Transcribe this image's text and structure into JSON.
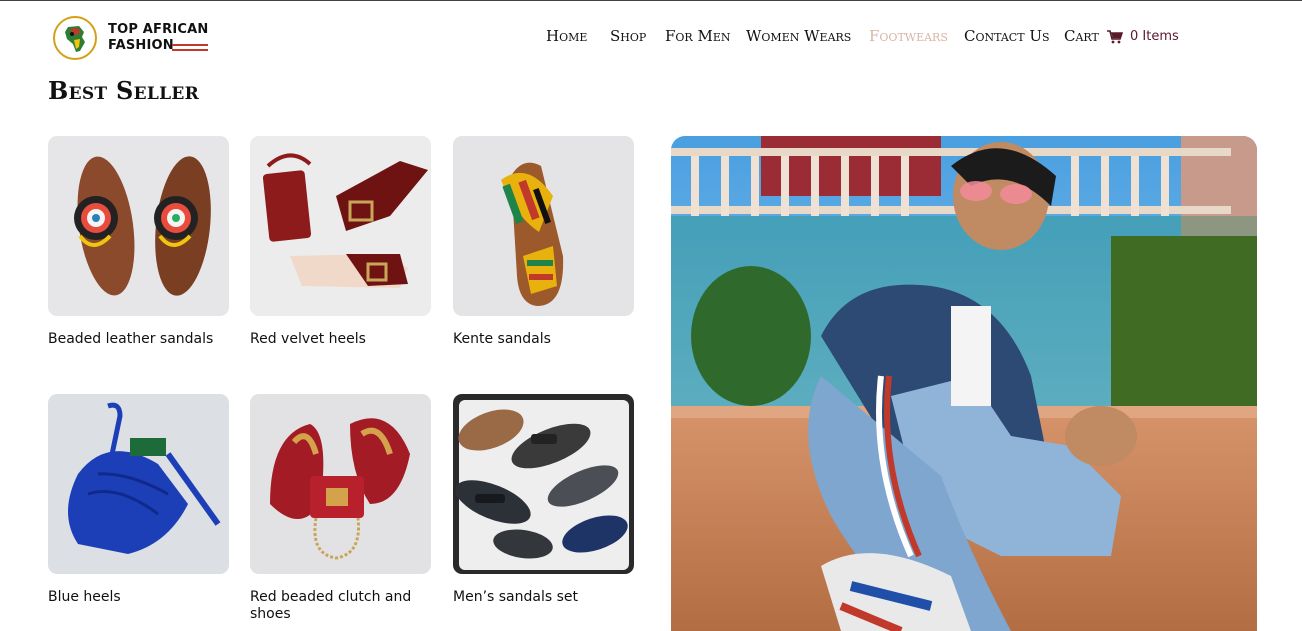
{
  "brand": {
    "name_line1": "TOP AFRICAN",
    "name_line2": "FASHION",
    "badge_text": "Top African Fashion"
  },
  "nav": {
    "items": [
      {
        "label": "Home",
        "active": false
      },
      {
        "label": "Shop",
        "active": false
      },
      {
        "label": "For Men",
        "active": false
      },
      {
        "label": "Women Wears",
        "active": false
      },
      {
        "label": "Footwears",
        "active": true
      },
      {
        "label": "Contact Us",
        "active": false
      },
      {
        "label": "Cart",
        "active": false
      }
    ],
    "cart_count": "0 Items"
  },
  "section": {
    "title": "Best Seller"
  },
  "products": [
    {
      "name": "Beaded leather sandals",
      "image": "beaded-leather-sandals"
    },
    {
      "name": "Red velvet heels",
      "image": "red-velvet-heels"
    },
    {
      "name": "Kente sandals",
      "image": "kente-sandals"
    },
    {
      "name": "Blue heels",
      "image": "blue-heels"
    },
    {
      "name": "Red beaded clutch and shoes",
      "image": "red-beaded-clutch-and-shoes"
    },
    {
      "name": "Men’s sandals set",
      "image": "mens-sandals-set"
    }
  ],
  "hero": {
    "image": "man-in-denim-jacket-sitting"
  },
  "colors": {
    "active_nav": "#d7b5a6",
    "cart_text": "#5a1a2a",
    "accent_red": "#c0392b"
  }
}
